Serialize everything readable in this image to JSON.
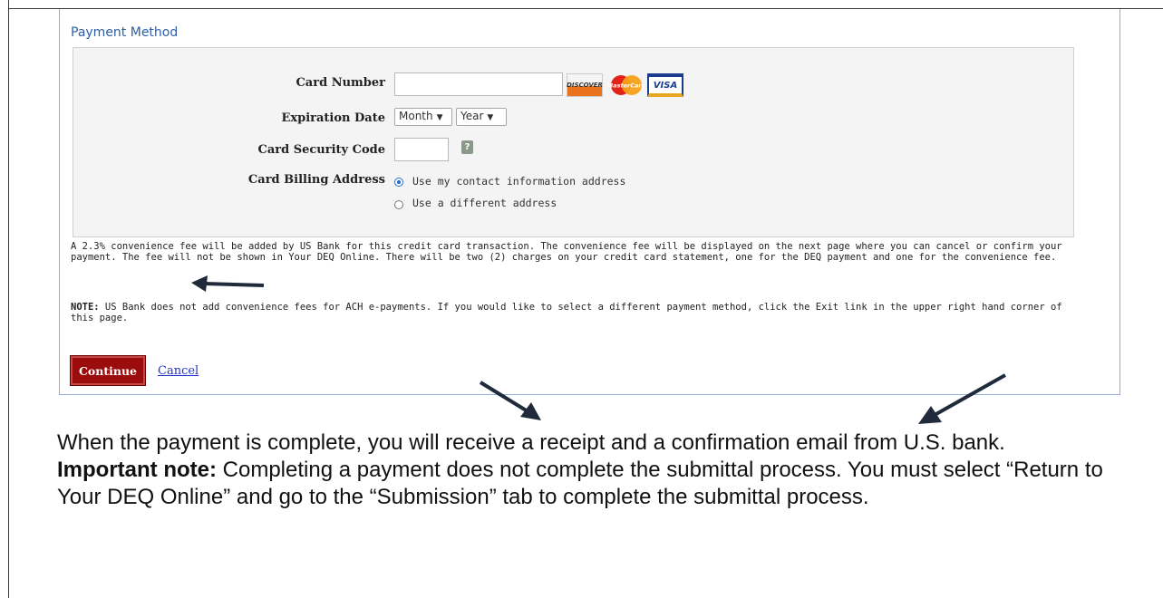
{
  "payment": {
    "title": "Payment Method",
    "card_number_label": "Card Number",
    "card_number_value": "",
    "expiration_label": "Expiration Date",
    "month_selected": "Month",
    "year_selected": "Year",
    "security_code_label": "Card Security Code",
    "security_code_value": "",
    "help_icon_glyph": "?",
    "billing_label": "Card Billing Address",
    "billing_option_1": "Use my contact information address",
    "billing_option_2": "Use a different address",
    "billing_selected": "Use my contact information address",
    "card_logos": {
      "discover": "DISCOVER",
      "mastercard": "MasterCard",
      "visa": "VISA"
    },
    "fee_notice": "A 2.3% convenience fee will be added by US Bank for this credit card transaction. The convenience fee will be displayed on the next page where you can cancel or confirm your payment. The fee will not be shown in Your DEQ Online. There will be two (2) charges on your credit card statement, one for the DEQ payment and one for the convenience fee.",
    "note_label": "NOTE:",
    "note_text": " US Bank does not add convenience fees for ACH e-payments. If you would like to select a different payment method, click the Exit link in the upper right hand corner of this page.",
    "continue_label": "Continue",
    "cancel_label": "Cancel"
  },
  "instructions": {
    "part1": "When the payment is complete, you will receive a receipt and a confirmation email from U.S. bank. ",
    "important_label": "Important note:",
    "part2": " Completing a payment does not complete the submittal process. You must select “Return to Your DEQ Online” and go to the “Submission” tab to complete the submittal process."
  },
  "colors": {
    "continue_button": "#9b0d0d",
    "link": "#2233cc",
    "title": "#2c5fa8",
    "arrow": "#1f2a3a"
  }
}
